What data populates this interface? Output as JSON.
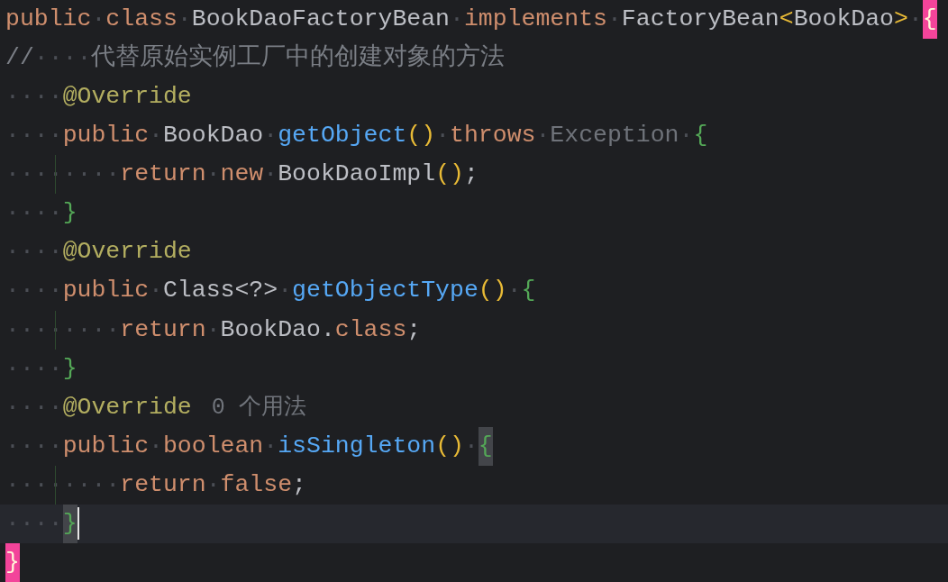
{
  "editor": {
    "lines": [
      {
        "tokens": [
          {
            "text": "public",
            "kind": "keyword"
          },
          {
            "text": "·",
            "kind": "ws"
          },
          {
            "text": "class",
            "kind": "keyword"
          },
          {
            "text": "·",
            "kind": "ws"
          },
          {
            "text": "BookDaoFactoryBean",
            "kind": "plain"
          },
          {
            "text": "·",
            "kind": "ws"
          },
          {
            "text": "implements",
            "kind": "keyword"
          },
          {
            "text": "·",
            "kind": "ws"
          },
          {
            "text": "FactoryBean",
            "kind": "plain"
          },
          {
            "text": "<",
            "kind": "paren"
          },
          {
            "text": "BookDao",
            "kind": "plain"
          },
          {
            "text": ">",
            "kind": "paren"
          },
          {
            "text": "·",
            "kind": "ws"
          },
          {
            "text": "{",
            "kind": "brace",
            "highlighted": true,
            "paired": false
          }
        ]
      },
      {
        "tokens": [
          {
            "text": "//",
            "kind": "comment"
          },
          {
            "text": "····",
            "kind": "ws"
          },
          {
            "text": "代替原始实例工厂中的创建对象的方法",
            "kind": "comment"
          }
        ]
      },
      {
        "tokens": [
          {
            "text": "····",
            "kind": "ws"
          },
          {
            "text": "@Override",
            "kind": "annotation"
          }
        ]
      },
      {
        "tokens": [
          {
            "text": "····",
            "kind": "ws"
          },
          {
            "text": "public",
            "kind": "keyword"
          },
          {
            "text": "·",
            "kind": "ws"
          },
          {
            "text": "BookDao",
            "kind": "plain"
          },
          {
            "text": "·",
            "kind": "ws"
          },
          {
            "text": "getObject",
            "kind": "function"
          },
          {
            "text": "()",
            "kind": "paren"
          },
          {
            "text": "·",
            "kind": "ws"
          },
          {
            "text": "throws",
            "kind": "keyword"
          },
          {
            "text": "·",
            "kind": "ws"
          },
          {
            "text": "Exception",
            "kind": "dim"
          },
          {
            "text": "·",
            "kind": "ws"
          },
          {
            "text": "{",
            "kind": "brace"
          }
        ]
      },
      {
        "guide": true,
        "tokens": [
          {
            "text": "········",
            "kind": "ws"
          },
          {
            "text": "return",
            "kind": "keyword"
          },
          {
            "text": "·",
            "kind": "ws"
          },
          {
            "text": "new",
            "kind": "keyword"
          },
          {
            "text": "·",
            "kind": "ws"
          },
          {
            "text": "BookDaoImpl",
            "kind": "plain"
          },
          {
            "text": "()",
            "kind": "paren"
          },
          {
            "text": ";",
            "kind": "plain"
          }
        ]
      },
      {
        "tokens": [
          {
            "text": "····",
            "kind": "ws"
          },
          {
            "text": "}",
            "kind": "brace"
          }
        ]
      },
      {
        "tokens": [
          {
            "text": "····",
            "kind": "ws"
          },
          {
            "text": "@Override",
            "kind": "annotation"
          }
        ]
      },
      {
        "tokens": [
          {
            "text": "····",
            "kind": "ws"
          },
          {
            "text": "public",
            "kind": "keyword"
          },
          {
            "text": "·",
            "kind": "ws"
          },
          {
            "text": "Class<?>",
            "kind": "plain"
          },
          {
            "text": "·",
            "kind": "ws"
          },
          {
            "text": "getObjectType",
            "kind": "function"
          },
          {
            "text": "()",
            "kind": "paren"
          },
          {
            "text": "·",
            "kind": "ws"
          },
          {
            "text": "{",
            "kind": "brace"
          }
        ]
      },
      {
        "guide": true,
        "tokens": [
          {
            "text": "········",
            "kind": "ws"
          },
          {
            "text": "return",
            "kind": "keyword"
          },
          {
            "text": "·",
            "kind": "ws"
          },
          {
            "text": "BookDao.",
            "kind": "plain"
          },
          {
            "text": "class",
            "kind": "keyword"
          },
          {
            "text": ";",
            "kind": "plain"
          }
        ]
      },
      {
        "tokens": [
          {
            "text": "····",
            "kind": "ws"
          },
          {
            "text": "}",
            "kind": "brace"
          }
        ]
      },
      {
        "tokens": [
          {
            "text": "····",
            "kind": "ws"
          },
          {
            "text": "@Override",
            "kind": "annotation"
          },
          {
            "text": "0 个用法",
            "kind": "hint"
          }
        ]
      },
      {
        "tokens": [
          {
            "text": "····",
            "kind": "ws"
          },
          {
            "text": "public",
            "kind": "keyword"
          },
          {
            "text": "·",
            "kind": "ws"
          },
          {
            "text": "boolean",
            "kind": "keyword"
          },
          {
            "text": "·",
            "kind": "ws"
          },
          {
            "text": "isSingleton",
            "kind": "function"
          },
          {
            "text": "()",
            "kind": "paren"
          },
          {
            "text": "·",
            "kind": "ws"
          },
          {
            "text": "{",
            "kind": "brace",
            "highlighted": true,
            "paired": true
          }
        ]
      },
      {
        "guide": true,
        "tokens": [
          {
            "text": "········",
            "kind": "ws"
          },
          {
            "text": "return",
            "kind": "keyword"
          },
          {
            "text": "·",
            "kind": "ws"
          },
          {
            "text": "false",
            "kind": "keyword"
          },
          {
            "text": ";",
            "kind": "plain"
          }
        ]
      },
      {
        "current": true,
        "tokens": [
          {
            "text": "····",
            "kind": "ws"
          },
          {
            "text": "}",
            "kind": "brace",
            "highlighted": true,
            "paired": true,
            "caret": true
          }
        ]
      },
      {
        "tokens": [
          {
            "text": "}",
            "kind": "brace",
            "highlighted": true,
            "paired": false
          }
        ]
      }
    ]
  }
}
